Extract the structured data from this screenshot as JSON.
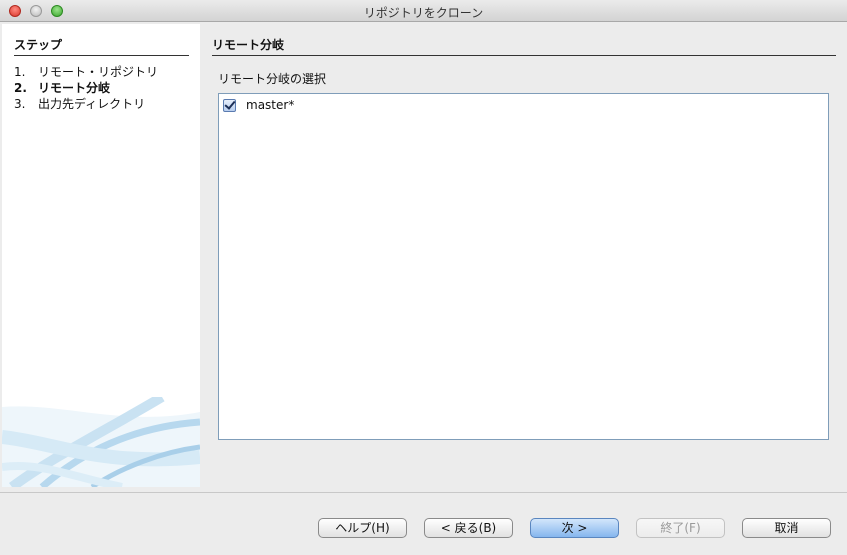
{
  "window": {
    "title": "リポジトリをクローン"
  },
  "steps": {
    "title": "ステップ",
    "items": [
      {
        "num": "1.",
        "label": "リモート・リポジトリ"
      },
      {
        "num": "2.",
        "label": "リモート分岐"
      },
      {
        "num": "3.",
        "label": "出力先ディレクトリ"
      }
    ]
  },
  "panel": {
    "title": "リモート分岐",
    "list_label": "リモート分岐の選択",
    "branches": [
      {
        "name": "master*",
        "checked": true
      }
    ]
  },
  "buttons": {
    "help": "ヘルプ(H)",
    "back": "< 戻る(B)",
    "next": "次 >",
    "finish": "終了(F)",
    "cancel": "取消"
  }
}
